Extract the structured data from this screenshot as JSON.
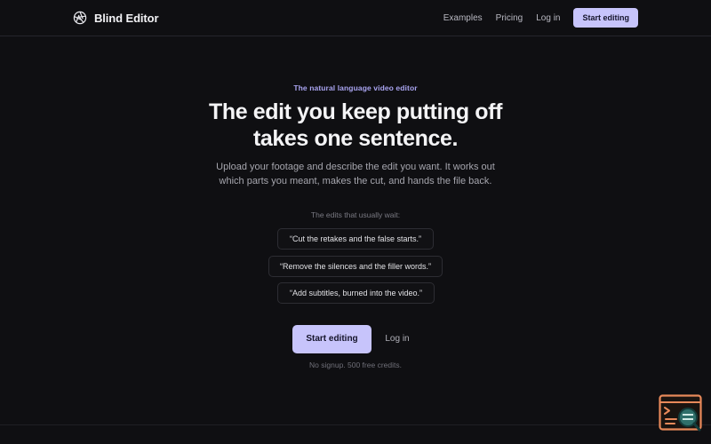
{
  "brand": {
    "name": "Blind Editor",
    "logo_icon": "aperture-icon"
  },
  "nav": {
    "links": [
      {
        "label": "Examples"
      },
      {
        "label": "Pricing"
      },
      {
        "label": "Log in"
      }
    ],
    "cta_label": "Start editing"
  },
  "hero": {
    "eyebrow": "The natural language video editor",
    "title_line1": "The edit you keep putting off",
    "title_line2": "takes one sentence.",
    "subtitle_line1": "Upload your footage and describe the edit you want. It works out",
    "subtitle_line2": "which parts you meant, makes the cut, and hands the file back.",
    "edits_label": "The edits that usually wait:",
    "edits": [
      "“Cut the retakes and the false starts.”",
      "“Remove the silences and the filler words.”",
      "“Add subtitles, burned into the video.”"
    ],
    "primary_cta": "Start editing",
    "secondary_cta": "Log in",
    "note": "No signup. 500 free credits."
  },
  "widget": {
    "icon": "terminal-search-icon"
  },
  "colors": {
    "background": "#0f0f12",
    "accent": "#c7c4fb",
    "eyebrow": "#a9a4f0",
    "widget_orange": "#e8895a",
    "widget_teal": "#2f6f6a"
  }
}
